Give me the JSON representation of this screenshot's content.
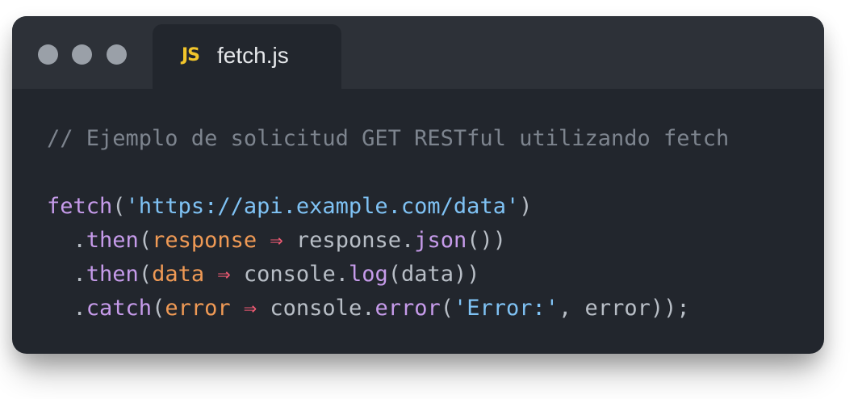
{
  "window": {
    "controls": [
      "close",
      "minimize",
      "maximize"
    ],
    "tab": {
      "icon": "JS",
      "label": "fetch.js"
    }
  },
  "code": {
    "comment": "// Ejemplo de solicitud GET RESTful utilizando fetch",
    "line1": {
      "fn": "fetch",
      "open": "(",
      "url": "'https://api.example.com/data'",
      "close": ")"
    },
    "line2": {
      "indent": "  .",
      "method": "then",
      "open": "(",
      "param": "response",
      "arrow": "⇒",
      "obj": "response.",
      "call": "json",
      "tail": "())"
    },
    "line3": {
      "indent": "  .",
      "method": "then",
      "open": "(",
      "param": "data",
      "arrow": "⇒",
      "obj": "console.",
      "call": "log",
      "tail": "(data))"
    },
    "line4": {
      "indent": "  .",
      "method": "catch",
      "open": "(",
      "param": "error",
      "arrow": "⇒",
      "obj": "console.",
      "call": "error",
      "open2": "(",
      "str": "'Error:'",
      "tail": ", error));"
    }
  },
  "colors": {
    "background": "#22262d",
    "titlebar": "#2d3138",
    "comment": "#7d848e",
    "function": "#c69bea",
    "string": "#7fc2f4",
    "parameter": "#f09a55",
    "arrow": "#f05a73",
    "js_icon": "#f2c52b"
  }
}
